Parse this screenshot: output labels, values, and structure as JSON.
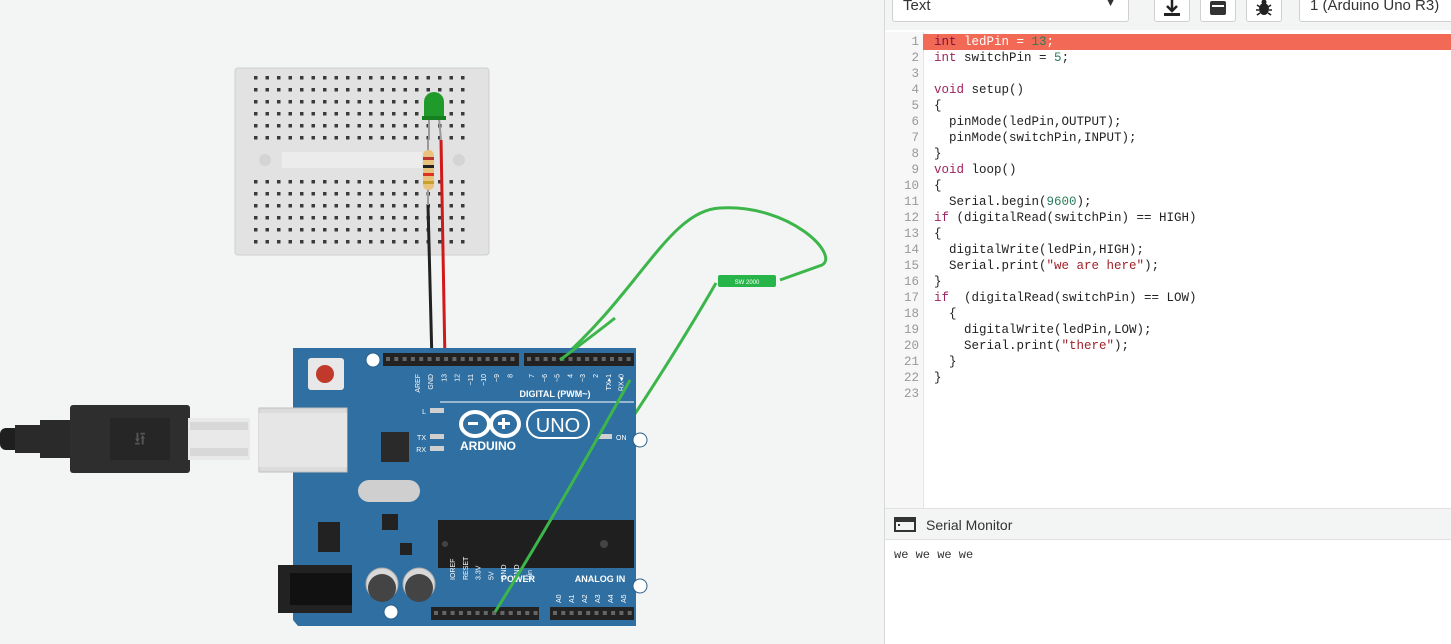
{
  "toolbar": {
    "mode_select": "Text",
    "board_select": "1 (Arduino Uno R3)",
    "icons": [
      "download-icon",
      "library-icon",
      "debug-bug-icon"
    ]
  },
  "code": {
    "lines": [
      {
        "num": "1",
        "text": "int ledPin = 13;",
        "error": true
      },
      {
        "num": "2",
        "text": "int switchPin = 5;"
      },
      {
        "num": "3",
        "text": ""
      },
      {
        "num": "4",
        "text": "void setup()"
      },
      {
        "num": "5",
        "text": "{"
      },
      {
        "num": "6",
        "text": "  pinMode(ledPin,OUTPUT);"
      },
      {
        "num": "7",
        "text": "  pinMode(switchPin,INPUT);"
      },
      {
        "num": "8",
        "text": "}"
      },
      {
        "num": "9",
        "text": "void loop()"
      },
      {
        "num": "10",
        "text": "{"
      },
      {
        "num": "11",
        "text": "  Serial.begin(9600);"
      },
      {
        "num": "12",
        "text": "if (digitalRead(switchPin) == HIGH)"
      },
      {
        "num": "13",
        "text": "{"
      },
      {
        "num": "14",
        "text": "  digitalWrite(ledPin,HIGH);"
      },
      {
        "num": "15",
        "text": "  Serial.print(\"we are here\");"
      },
      {
        "num": "16",
        "text": "}"
      },
      {
        "num": "17",
        "text": "if  (digitalRead(switchPin) == LOW)"
      },
      {
        "num": "18",
        "text": "  {"
      },
      {
        "num": "19",
        "text": "    digitalWrite(ledPin,LOW);"
      },
      {
        "num": "20",
        "text": "    Serial.print(\"there\");"
      },
      {
        "num": "21",
        "text": "  }"
      },
      {
        "num": "22",
        "text": "}"
      },
      {
        "num": "23",
        "text": ""
      }
    ]
  },
  "serial_monitor": {
    "title": "Serial Monitor",
    "output": "we we we we"
  },
  "circuit": {
    "board_brand": "ARDUINO",
    "board_model": "UNO",
    "digital_label": "DIGITAL (PWM~)",
    "power_label": "POWER",
    "analog_label": "ANALOG IN",
    "on_label": "ON",
    "l_label": "L",
    "tx_label": "TX",
    "rx_label": "RX",
    "switch_label": "SW 2000",
    "digital_pins": [
      "AREF",
      "GND",
      "13",
      "12",
      "~11",
      "~10",
      "~9",
      "8",
      "7",
      "~6",
      "~5",
      "4",
      "~3",
      "2",
      "TX▸1",
      "RX◂0"
    ],
    "power_pins": [
      "IOREF",
      "RESET",
      "3.3V",
      "5V",
      "GND",
      "GND",
      "Vin"
    ],
    "analog_pins": [
      "A0",
      "A1",
      "A2",
      "A3",
      "A4",
      "A5"
    ],
    "colors": {
      "board": "#2f6fa1",
      "wire_green": "#3cb64a",
      "wire_red": "#d11919",
      "wire_black": "#222222",
      "led": "#1f9a2b",
      "error_line": "#f26a55"
    }
  }
}
